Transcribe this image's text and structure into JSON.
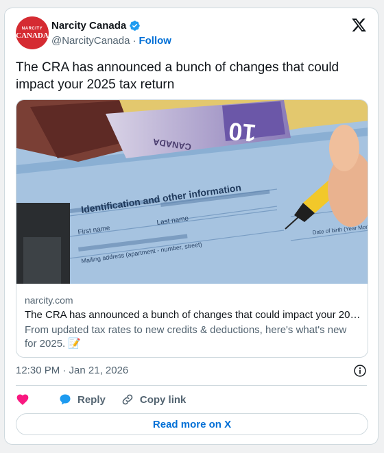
{
  "account": {
    "name": "Narcity Canada",
    "handle": "@NarcityCanada",
    "separator": "·",
    "follow_label": "Follow",
    "avatar_text_top": "NARCITY",
    "avatar_text_bottom": "CANADA",
    "verified": true
  },
  "tweet": {
    "text": "The CRA has announced a bunch of changes that could impact your 2025 tax return",
    "timestamp": "12:30 PM · Jan 21, 2026"
  },
  "link_card": {
    "domain": "narcity.com",
    "title": "The CRA has announced a bunch of changes that could impact your 20…",
    "description": "From updated tax rates to new credits & deductions, here's what's new for 2025. 📝",
    "image_texts": {
      "banknote": "CANADA",
      "banknote_number": "10",
      "form_heading": "Identification and other information",
      "first_name": "First name",
      "last_name": "Last name",
      "address": "Mailing address (apartment - number, street)",
      "date_label": "Date of birth (Year Month Day)"
    }
  },
  "actions": {
    "reply_label": "Reply",
    "copy_link_label": "Copy link",
    "read_more_label": "Read more on X"
  },
  "icons": {
    "verified": "verified-badge-icon",
    "x_logo": "x-logo-icon",
    "info": "info-icon",
    "heart": "heart-icon",
    "reply": "reply-bubble-icon",
    "copy_link": "link-icon"
  },
  "colors": {
    "link_blue": "#006fd6",
    "verified_blue": "#1d9bf0",
    "heart_pink": "#f91880",
    "muted_text": "#536471",
    "border": "#cfd9de",
    "avatar_red": "#d52b32"
  }
}
